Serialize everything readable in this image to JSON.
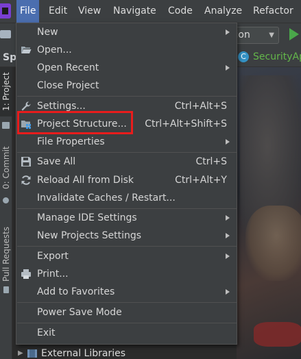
{
  "menubar": {
    "items": [
      {
        "label": "File"
      },
      {
        "label": "Edit"
      },
      {
        "label": "View"
      },
      {
        "label": "Navigate"
      },
      {
        "label": "Code"
      },
      {
        "label": "Analyze"
      },
      {
        "label": "Refactor"
      }
    ]
  },
  "toolbar": {
    "run_config_label": "tion"
  },
  "project_header": {
    "label": "Spr"
  },
  "editor_tab": {
    "label": "SecurityAp"
  },
  "left_strip": {
    "project_label": "1: Project",
    "commit_label": "0: Commit",
    "pull_requests_label": "Pull Requests"
  },
  "project_tree": {
    "external_libraries": "External Libraries"
  },
  "file_menu": {
    "items": [
      {
        "label": "New",
        "shortcut": "",
        "submenu": true
      },
      {
        "label": "Open...",
        "shortcut": "",
        "submenu": false
      },
      {
        "label": "Open Recent",
        "shortcut": "",
        "submenu": true
      },
      {
        "label": "Close Project",
        "shortcut": "",
        "submenu": false
      },
      {
        "label": "Settings...",
        "shortcut": "Ctrl+Alt+S",
        "submenu": false
      },
      {
        "label": "Project Structure...",
        "shortcut": "Ctrl+Alt+Shift+S",
        "submenu": false
      },
      {
        "label": "File Properties",
        "shortcut": "",
        "submenu": true
      },
      {
        "label": "Save All",
        "shortcut": "Ctrl+S",
        "submenu": false
      },
      {
        "label": "Reload All from Disk",
        "shortcut": "Ctrl+Alt+Y",
        "submenu": false
      },
      {
        "label": "Invalidate Caches / Restart...",
        "shortcut": "",
        "submenu": false
      },
      {
        "label": "Manage IDE Settings",
        "shortcut": "",
        "submenu": true
      },
      {
        "label": "New Projects Settings",
        "shortcut": "",
        "submenu": true
      },
      {
        "label": "Export",
        "shortcut": "",
        "submenu": true
      },
      {
        "label": "Print...",
        "shortcut": "",
        "submenu": false
      },
      {
        "label": "Add to Favorites",
        "shortcut": "",
        "submenu": true
      },
      {
        "label": "Power Save Mode",
        "shortcut": "",
        "submenu": false
      },
      {
        "label": "Exit",
        "shortcut": "",
        "submenu": false
      }
    ],
    "highlighted_item": "Project Structure...",
    "highlight_color": "#e81c1c"
  },
  "colors": {
    "menubar_bg": "#3c3f41",
    "active_menu_bg": "#4b6eaf",
    "run_green": "#4aa74a",
    "tab_text_green": "#63b74a"
  },
  "icons": {
    "open": "folder-open-icon",
    "settings": "wrench-icon",
    "project_structure": "project-structure-icon",
    "save_all": "floppy-disk-icon",
    "reload": "reload-icon",
    "print": "printer-icon"
  }
}
